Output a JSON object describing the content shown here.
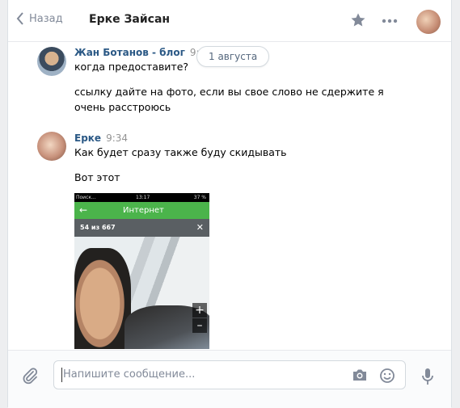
{
  "header": {
    "back_label": "Назад",
    "chat_title": "Ерке Зайсан"
  },
  "date_pill": "1 августа",
  "messages": [
    {
      "author": "Жан Ботанов - блог",
      "time": "9:33",
      "lines": [
        "когда предоставите?",
        "ссылку дайте на фото, если вы свое слово не сдержите я",
        "очень расстроюсь"
      ]
    },
    {
      "author": "Ерке",
      "time": "9:34",
      "lines": [
        "Как будет сразу также буду скидывать",
        "Вот этот"
      ]
    }
  ],
  "attachment_photo": {
    "status_carrier": "Поиск...",
    "status_time": "13:17",
    "status_battery": "37 %",
    "app_title": "Интернет",
    "counter": "54 из 667",
    "zoom_in": "+",
    "zoom_out": "–"
  },
  "composer": {
    "placeholder": "Напишите сообщение..."
  },
  "colors": {
    "link_blue": "#2a5885",
    "muted": "#828a99",
    "app_green": "#4bb44b"
  }
}
